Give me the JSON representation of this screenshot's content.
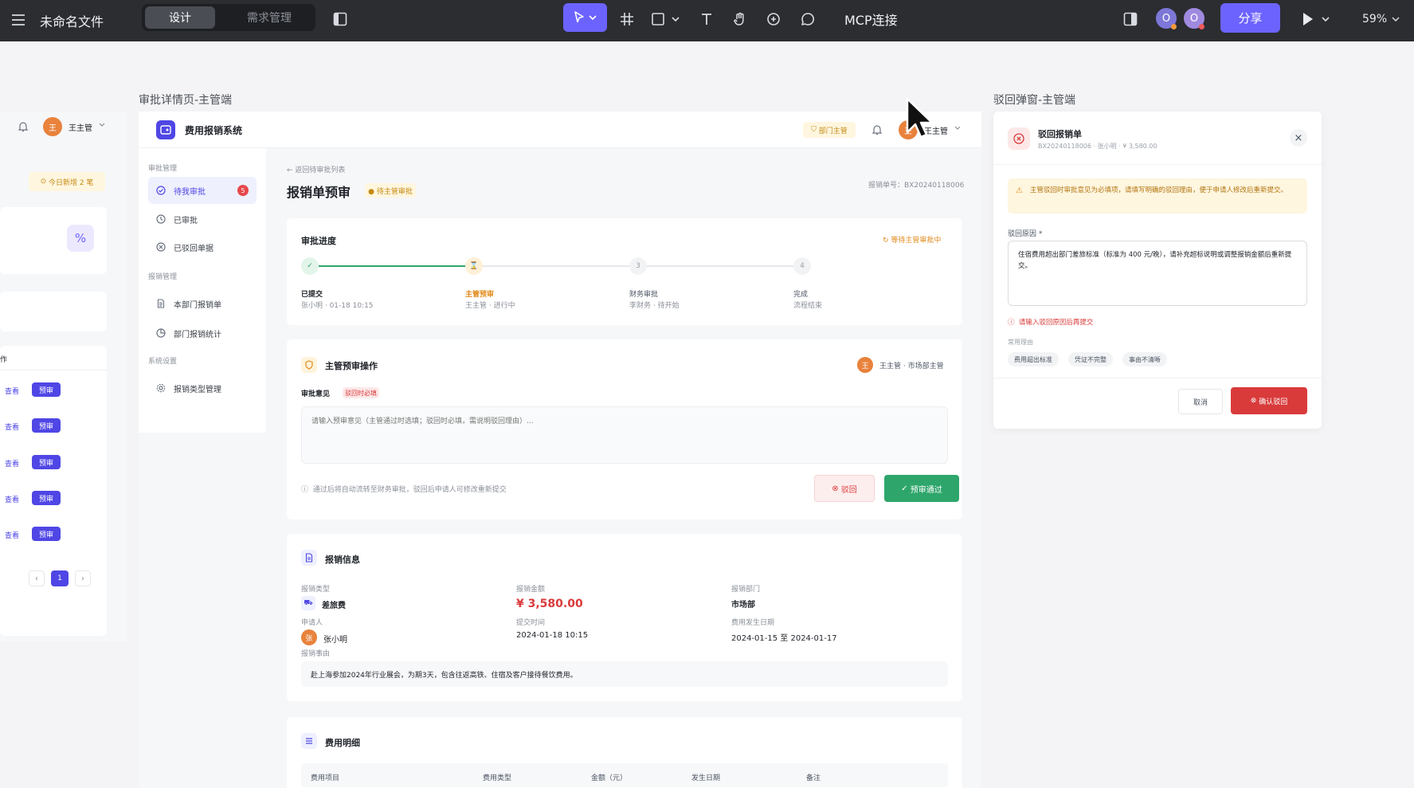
{
  "toolbar": {
    "file_name": "未命名文件",
    "mode_tabs": [
      "设计",
      "需求管理"
    ],
    "mcp_label": "MCP连接",
    "avatar_letter": "O",
    "share_label": "分享",
    "zoom": "59%"
  },
  "frames": {
    "detail_label": "审批详情页-主管端",
    "modal_label": "驳回弹窗-主管端"
  },
  "left_frame": {
    "user_name": "王主管",
    "avatar_letter": "王",
    "today_badge": "今日新增 2 笔",
    "ops_header": "作",
    "row_view": "查看",
    "row_action": "预审",
    "page_current": "1",
    "prev": "‹",
    "next": "›"
  },
  "detail": {
    "app_name": "费用报销系统",
    "role_badge": "部门主管",
    "user_name": "王主管",
    "avatar_letter": "王",
    "sidebar": {
      "group1": "审批管理",
      "pending": "待我审批",
      "pending_count": "5",
      "approved": "已审批",
      "rejected": "已驳回单据",
      "group2": "报销管理",
      "dept_forms": "本部门报销单",
      "dept_stats": "部门报销统计",
      "group3": "系统设置",
      "types": "报销类型管理"
    },
    "back_link": "← 返回待审批列表",
    "page_title": "报销单预审",
    "status_tag": "● 待主管审批",
    "form_no": "报销单号：BX20240118006",
    "progress": {
      "title": "审批进度",
      "status": "等待主管审批中",
      "steps": [
        {
          "label": "已提交",
          "sub": "张小明 · 01-18 10:15",
          "mark": "✓"
        },
        {
          "label": "主管预审",
          "sub": "王主管 · 进行中",
          "mark": "⌛"
        },
        {
          "label": "财务审批",
          "sub": "李财务 · 待开始",
          "mark": "3"
        },
        {
          "label": "完成",
          "sub": "流程结束",
          "mark": "4"
        }
      ]
    },
    "op": {
      "title": "主管预审操作",
      "user": "王主管 · 市场部主管",
      "avatar_letter": "王",
      "opinion_label": "审批意见",
      "required_tag": "驳回时必填",
      "placeholder": "请输入预审意见（主管通过时选填；驳回时必填，需说明驳回理由）...",
      "hint": "通过后将自动流转至财务审批，驳回后申请人可修改重新提交",
      "reject": "驳回",
      "approve": "预审通过"
    },
    "info": {
      "title": "报销信息",
      "type_label": "报销类型",
      "type_value": "差旅费",
      "amount_label": "报销金额",
      "amount_value": "¥ 3,580.00",
      "dept_label": "报销部门",
      "dept_value": "市场部",
      "applicant_label": "申请人",
      "applicant_value": "张小明",
      "applicant_letter": "张",
      "time_label": "提交时间",
      "time_value": "2024-01-18 10:15",
      "date_label": "费用发生日期",
      "date_value": "2024-01-15 至 2024-01-17",
      "reason_label": "报销事由",
      "reason_value": "赴上海参加2024年行业展会，为期3天，包含往返高铁、住宿及客户接待餐饮费用。"
    },
    "detail_table": {
      "title": "费用明细",
      "headers": [
        "费用项目",
        "费用类型",
        "金额（元）",
        "发生日期",
        "备注"
      ]
    }
  },
  "modal": {
    "title": "驳回报销单",
    "sub": "BX20240118006 · 张小明 · ¥ 3,580.00",
    "alert": "主管驳回时审批意见为必填项，请填写明确的驳回理由，便于申请人修改后重新提交。",
    "reason_label": "驳回原因 *",
    "reason_text": "住宿费用超出部门差旅标准（标准为 400 元/晚），请补充超标说明或调整报销金额后重新提交。",
    "error": "请输入驳回原因后再提交",
    "common_label": "常用理由",
    "chips": [
      "费用超出标准",
      "凭证不完整",
      "事由不清晰"
    ],
    "cancel": "取消",
    "confirm": "确认驳回",
    "close": "×"
  },
  "colors": {
    "topbar": "#2b2d31",
    "accent": "#6c63ff",
    "brand": "#4f46e5",
    "success": "#2ea66b",
    "danger": "#d93b3b",
    "warning": "#f0a020"
  }
}
